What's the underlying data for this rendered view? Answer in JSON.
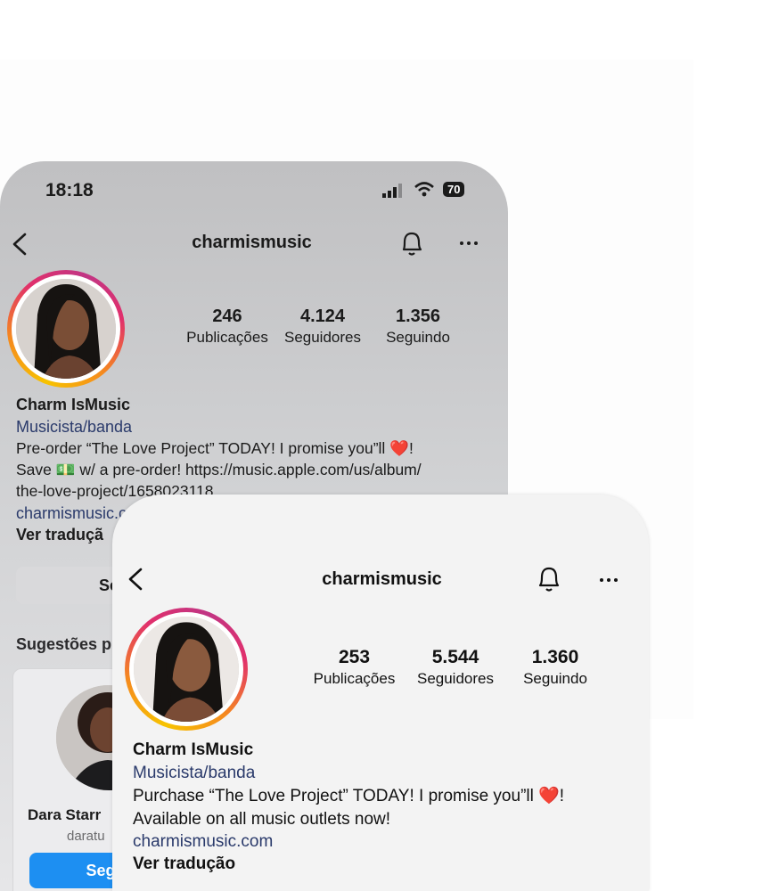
{
  "back": {
    "status": {
      "time": "18:18",
      "battery": "70"
    },
    "username": "charmismusic",
    "stats": [
      {
        "value": "246",
        "label": "Publicações"
      },
      {
        "value": "4.124",
        "label": "Seguidores"
      },
      {
        "value": "1.356",
        "label": "Seguindo"
      }
    ],
    "name": "Charm IsMusic",
    "category": "Musicista/banda",
    "bio": "Pre-order “The Love Project” TODAY! I promise you”ll ❤️!\nSave 💵 w/ a pre-order! https://music.apple.com/us/album/\nthe-love-project/1658023118",
    "link": "charmismusic.c",
    "translate": "Ver traduçã",
    "follow_button": "Segu",
    "suggestions_title": "Sugestões p",
    "suggestion": {
      "name": "Dara Starr",
      "handle": "daratu",
      "button": "Seg"
    }
  },
  "front": {
    "username": "charmismusic",
    "stats": [
      {
        "value": "253",
        "label": "Publicações"
      },
      {
        "value": "5.544",
        "label": "Seguidores"
      },
      {
        "value": "1.360",
        "label": "Seguindo"
      }
    ],
    "name": "Charm IsMusic",
    "category": "Musicista/banda",
    "bio": "Purchase “The Love Project” TODAY! I promise you”ll ❤️!\nAvailable on all music outlets now!",
    "link": "charmismusic.com",
    "translate": "Ver tradução"
  },
  "colors": {
    "link": "#2a3a6b",
    "primary_button": "#1d8ff2"
  }
}
